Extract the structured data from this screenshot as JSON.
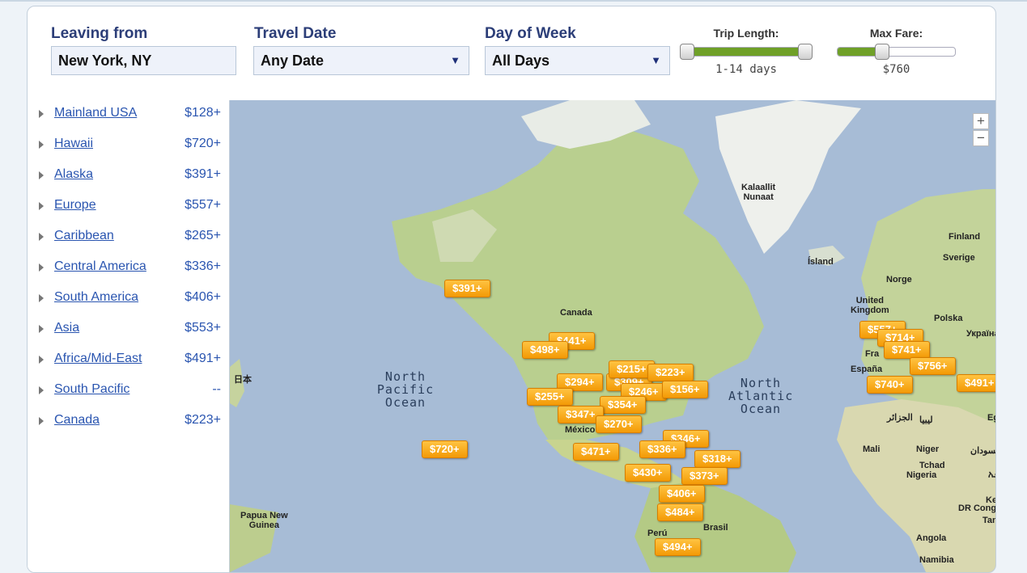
{
  "filters": {
    "leaving_from": {
      "label": "Leaving from",
      "value": "New York, NY"
    },
    "travel_date": {
      "label": "Travel Date",
      "value": "Any Date"
    },
    "day_of_week": {
      "label": "Day of Week",
      "value": "All Days"
    },
    "trip_length": {
      "label": "Trip Length:",
      "value": "1-14 days",
      "min_fraction": 0.0,
      "max_fraction": 1.0
    },
    "max_fare": {
      "label": "Max Fare:",
      "value": "$760",
      "fraction": 0.36
    }
  },
  "regions": [
    {
      "name": "Mainland USA",
      "price": "$128+"
    },
    {
      "name": "Hawaii",
      "price": "$720+"
    },
    {
      "name": "Alaska",
      "price": "$391+"
    },
    {
      "name": "Europe",
      "price": "$557+"
    },
    {
      "name": "Caribbean",
      "price": "$265+"
    },
    {
      "name": "Central America",
      "price": "$336+"
    },
    {
      "name": "South America",
      "price": "$406+"
    },
    {
      "name": "Asia",
      "price": "$553+"
    },
    {
      "name": "Africa/Mid-East",
      "price": "$491+"
    },
    {
      "name": "South Pacific",
      "price": "--"
    },
    {
      "name": "Canada",
      "price": "$223+"
    }
  ],
  "map": {
    "oceans": [
      "North\nPacific\nOcean",
      "North\nAtlantic\nOcean"
    ],
    "places": [
      "Kalaallit\nNunaat",
      "Canada",
      "Ísland",
      "Finland",
      "Sverige",
      "Norge",
      "United\nKingdom",
      "Polska",
      "Україна",
      "Fra",
      "España",
      "الجزائر",
      "ليبيا",
      "Egy",
      "Mali",
      "Niger",
      "السودان",
      "Tchad",
      "Nigeria",
      "DR Congo",
      "Kenya",
      "Tanzani",
      "Angola",
      "Namibia",
      "México",
      "Perú",
      "Brasil",
      "Papua New\nGuinea",
      "日本",
      "ኢትዮጵ"
    ],
    "fare_pins": [
      "$391+",
      "$441+",
      "$498+",
      "$294+",
      "$309+",
      "$215+",
      "$223+",
      "$246+",
      "$156+",
      "$255+",
      "$354+",
      "$347+",
      "$270+",
      "$346+",
      "$471+",
      "$336+",
      "$318+",
      "$430+",
      "$373+",
      "$406+",
      "$484+",
      "$494+",
      "$720+",
      "$557+",
      "$714+",
      "$741+",
      "$756+",
      "$740+",
      "$491+"
    ],
    "zoom_in": "+",
    "zoom_out": "−"
  },
  "colors": {
    "pin": "#f7a91c",
    "link": "#2a55b0",
    "heading": "#2c3e78",
    "slider_fill": "#6fa028",
    "ocean": "#a7bcd6",
    "land": "#c9d7a0"
  }
}
